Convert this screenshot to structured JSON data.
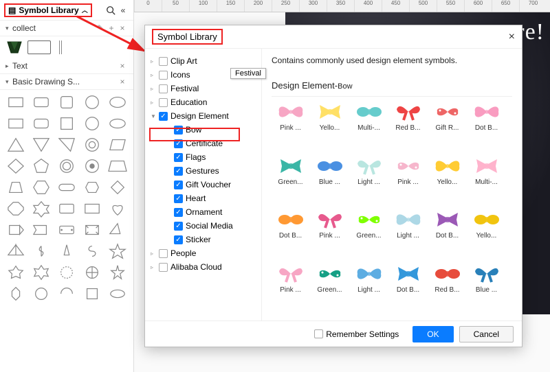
{
  "left_panel": {
    "title": "Symbol Library",
    "sections": {
      "collect": {
        "title": "collect"
      },
      "text": {
        "title": "Text"
      },
      "shapes": {
        "title": "Basic Drawing S..."
      }
    }
  },
  "ruler_marks": [
    "0",
    "50",
    "100",
    "150",
    "200",
    "250",
    "300",
    "350",
    "400",
    "450",
    "500",
    "550",
    "600",
    "650",
    "700"
  ],
  "banner_text": "ere!",
  "dialog": {
    "title": "Symbol Library",
    "description": "Contains commonly used design element symbols.",
    "grid_title": "Design Element-",
    "grid_title_sub": "Bow",
    "tree": [
      {
        "label": "Clip Art",
        "checked": false,
        "expandable": true
      },
      {
        "label": "Icons",
        "checked": false,
        "expandable": true
      },
      {
        "label": "Festival",
        "checked": false,
        "expandable": true
      },
      {
        "label": "Education",
        "checked": false,
        "expandable": true
      },
      {
        "label": "Design Element",
        "checked": true,
        "expandable": true,
        "expanded": true
      },
      {
        "label": "Bow",
        "checked": true,
        "sub": true
      },
      {
        "label": "Certificate",
        "checked": true,
        "sub": true
      },
      {
        "label": "Flags",
        "checked": true,
        "sub": true
      },
      {
        "label": "Gestures",
        "checked": true,
        "sub": true
      },
      {
        "label": "Gift Voucher",
        "checked": true,
        "sub": true
      },
      {
        "label": "Heart",
        "checked": true,
        "sub": true
      },
      {
        "label": "Ornament",
        "checked": true,
        "sub": true
      },
      {
        "label": "Social Media",
        "checked": true,
        "sub": true
      },
      {
        "label": "Sticker",
        "checked": true,
        "sub": true
      },
      {
        "label": "People",
        "checked": false,
        "expandable": true
      },
      {
        "label": "Alibaba Cloud",
        "checked": false,
        "expandable": true
      }
    ],
    "tooltip": "Festival",
    "bows": [
      {
        "label": "Pink ...",
        "color": "#f7a6c4"
      },
      {
        "label": "Yello...",
        "color": "#ffe066"
      },
      {
        "label": "Multi-...",
        "color": "#6cc"
      },
      {
        "label": "Red B...",
        "color": "#e44"
      },
      {
        "label": "Gift R...",
        "color": "#e66"
      },
      {
        "label": "Dot B...",
        "color": "#f99cc0"
      },
      {
        "label": "Green...",
        "color": "#3bb6a6"
      },
      {
        "label": "Blue ...",
        "color": "#4a90e2"
      },
      {
        "label": "Light ...",
        "color": "#b9e6e0"
      },
      {
        "label": "Pink ...",
        "color": "#f6b6cc"
      },
      {
        "label": "Yello...",
        "color": "#ffcc33"
      },
      {
        "label": "Multi-...",
        "color": "#ffb3cc"
      },
      {
        "label": "Dot B...",
        "color": "#ff9933"
      },
      {
        "label": "Pink ...",
        "color": "#e75a8d"
      },
      {
        "label": "Green...",
        "color": "#7FFF00"
      },
      {
        "label": "Light ...",
        "color": "#add8e6"
      },
      {
        "label": "Dot B...",
        "color": "#9b59b6"
      },
      {
        "label": "Yello...",
        "color": "#f1c40f"
      },
      {
        "label": "Pink ...",
        "color": "#f7a6c4"
      },
      {
        "label": "Green...",
        "color": "#16a085"
      },
      {
        "label": "Light ...",
        "color": "#5dade2"
      },
      {
        "label": "Dot B...",
        "color": "#3498db"
      },
      {
        "label": "Red B...",
        "color": "#e74c3c"
      },
      {
        "label": "Blue ...",
        "color": "#2980b9"
      }
    ],
    "remember": "Remember Settings",
    "ok": "OK",
    "cancel": "Cancel"
  }
}
